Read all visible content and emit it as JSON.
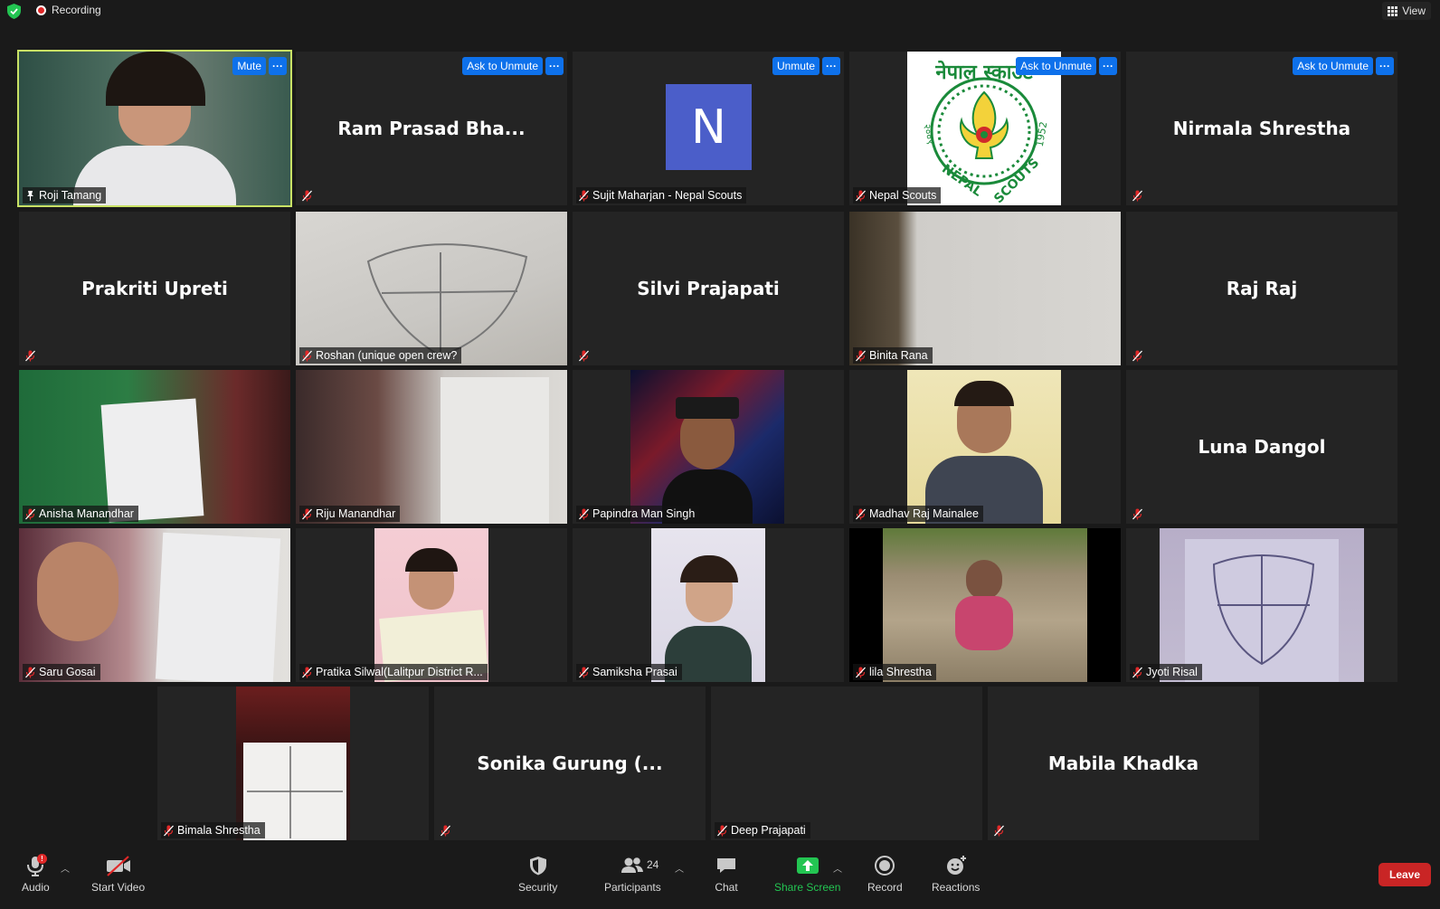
{
  "topbar": {
    "recording_label": "Recording",
    "view_label": "View"
  },
  "tiles": [
    {
      "name": "Roji Tamang",
      "display": "",
      "buttons": [
        "Mute",
        "···"
      ],
      "video": true,
      "active": true
    },
    {
      "name": "",
      "display": "Ram Prasad Bha...",
      "buttons": [
        "Ask to Unmute",
        "···"
      ],
      "video": false
    },
    {
      "name": "Sujit Maharjan - Nepal Scouts",
      "display": "",
      "buttons": [
        "Unmute",
        "···"
      ],
      "avatar_letter": "N"
    },
    {
      "name": "Nepal Scouts",
      "display": "",
      "buttons": [
        "Ask to Unmute",
        "···"
      ],
      "logo_top": "नेपाल स्काउट",
      "logo_left": "NEPAL",
      "logo_right": "SCOUTS",
      "logo_year": "1952",
      "logo_num": "२००९"
    },
    {
      "name": "",
      "display": "Nirmala Shrestha",
      "buttons": [
        "Ask to Unmute",
        "···"
      ]
    },
    {
      "name": "",
      "display": "Prakriti Upreti"
    },
    {
      "name": "Roshan (unique open crew?",
      "display": "",
      "video": true
    },
    {
      "name": "",
      "display": "Silvi Prajapati"
    },
    {
      "name": "Binita Rana",
      "display": "",
      "video": true
    },
    {
      "name": "",
      "display": "Raj Raj"
    },
    {
      "name": "Anisha Manandhar",
      "display": "",
      "video": true
    },
    {
      "name": "Riju Manandhar",
      "display": "",
      "video": true
    },
    {
      "name": "Papindra Man Singh",
      "display": "",
      "video": true
    },
    {
      "name": "Madhav Raj Mainalee",
      "display": "",
      "video": true
    },
    {
      "name": "",
      "display": "Luna Dangol"
    },
    {
      "name": "Saru Gosai",
      "display": "",
      "video": true
    },
    {
      "name": "Pratika Silwal(Lalitpur District R...",
      "display": "",
      "video": true
    },
    {
      "name": "Samiksha Prasai",
      "display": "",
      "video": true
    },
    {
      "name": "lila Shrestha",
      "display": "",
      "video": true
    },
    {
      "name": "Jyoti Risal",
      "display": "",
      "video": true
    },
    {
      "name": "Bimala Shrestha",
      "display": "",
      "video": true
    },
    {
      "name": "",
      "display": "Sonika Gurung (..."
    },
    {
      "name": "Deep Prajapati",
      "display": ""
    },
    {
      "name": "",
      "display": "Mabila Khadka"
    }
  ],
  "toolbar": {
    "audio": "Audio",
    "audio_badge": "!",
    "start_video": "Start Video",
    "security": "Security",
    "participants": "Participants",
    "participants_count": "24",
    "chat": "Chat",
    "share_screen": "Share Screen",
    "record": "Record",
    "reactions": "Reactions",
    "leave": "Leave"
  },
  "colors": {
    "accent_blue": "#0e71eb",
    "active_speaker": "#c9e265",
    "leave_red": "#c92525",
    "share_green": "#23c552"
  }
}
